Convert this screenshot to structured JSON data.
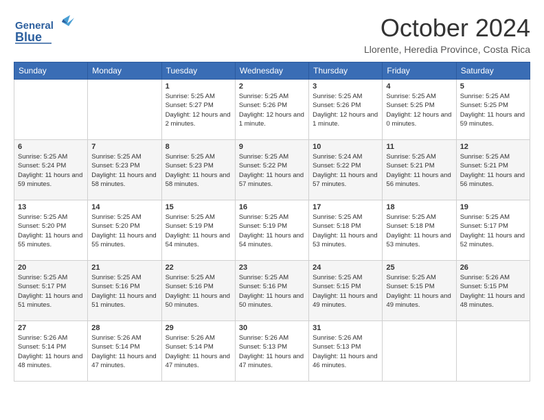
{
  "header": {
    "logo": {
      "general": "General",
      "blue": "Blue",
      "tagline": "GeneralBlue"
    },
    "title": "October 2024",
    "location": "Llorente, Heredia Province, Costa Rica"
  },
  "calendar": {
    "weekdays": [
      "Sunday",
      "Monday",
      "Tuesday",
      "Wednesday",
      "Thursday",
      "Friday",
      "Saturday"
    ],
    "weeks": [
      [
        {
          "day": "",
          "sunrise": "",
          "sunset": "",
          "daylight": ""
        },
        {
          "day": "",
          "sunrise": "",
          "sunset": "",
          "daylight": ""
        },
        {
          "day": "1",
          "sunrise": "Sunrise: 5:25 AM",
          "sunset": "Sunset: 5:27 PM",
          "daylight": "Daylight: 12 hours and 2 minutes."
        },
        {
          "day": "2",
          "sunrise": "Sunrise: 5:25 AM",
          "sunset": "Sunset: 5:26 PM",
          "daylight": "Daylight: 12 hours and 1 minute."
        },
        {
          "day": "3",
          "sunrise": "Sunrise: 5:25 AM",
          "sunset": "Sunset: 5:26 PM",
          "daylight": "Daylight: 12 hours and 1 minute."
        },
        {
          "day": "4",
          "sunrise": "Sunrise: 5:25 AM",
          "sunset": "Sunset: 5:25 PM",
          "daylight": "Daylight: 12 hours and 0 minutes."
        },
        {
          "day": "5",
          "sunrise": "Sunrise: 5:25 AM",
          "sunset": "Sunset: 5:25 PM",
          "daylight": "Daylight: 11 hours and 59 minutes."
        }
      ],
      [
        {
          "day": "6",
          "sunrise": "Sunrise: 5:25 AM",
          "sunset": "Sunset: 5:24 PM",
          "daylight": "Daylight: 11 hours and 59 minutes."
        },
        {
          "day": "7",
          "sunrise": "Sunrise: 5:25 AM",
          "sunset": "Sunset: 5:23 PM",
          "daylight": "Daylight: 11 hours and 58 minutes."
        },
        {
          "day": "8",
          "sunrise": "Sunrise: 5:25 AM",
          "sunset": "Sunset: 5:23 PM",
          "daylight": "Daylight: 11 hours and 58 minutes."
        },
        {
          "day": "9",
          "sunrise": "Sunrise: 5:25 AM",
          "sunset": "Sunset: 5:22 PM",
          "daylight": "Daylight: 11 hours and 57 minutes."
        },
        {
          "day": "10",
          "sunrise": "Sunrise: 5:24 AM",
          "sunset": "Sunset: 5:22 PM",
          "daylight": "Daylight: 11 hours and 57 minutes."
        },
        {
          "day": "11",
          "sunrise": "Sunrise: 5:25 AM",
          "sunset": "Sunset: 5:21 PM",
          "daylight": "Daylight: 11 hours and 56 minutes."
        },
        {
          "day": "12",
          "sunrise": "Sunrise: 5:25 AM",
          "sunset": "Sunset: 5:21 PM",
          "daylight": "Daylight: 11 hours and 56 minutes."
        }
      ],
      [
        {
          "day": "13",
          "sunrise": "Sunrise: 5:25 AM",
          "sunset": "Sunset: 5:20 PM",
          "daylight": "Daylight: 11 hours and 55 minutes."
        },
        {
          "day": "14",
          "sunrise": "Sunrise: 5:25 AM",
          "sunset": "Sunset: 5:20 PM",
          "daylight": "Daylight: 11 hours and 55 minutes."
        },
        {
          "day": "15",
          "sunrise": "Sunrise: 5:25 AM",
          "sunset": "Sunset: 5:19 PM",
          "daylight": "Daylight: 11 hours and 54 minutes."
        },
        {
          "day": "16",
          "sunrise": "Sunrise: 5:25 AM",
          "sunset": "Sunset: 5:19 PM",
          "daylight": "Daylight: 11 hours and 54 minutes."
        },
        {
          "day": "17",
          "sunrise": "Sunrise: 5:25 AM",
          "sunset": "Sunset: 5:18 PM",
          "daylight": "Daylight: 11 hours and 53 minutes."
        },
        {
          "day": "18",
          "sunrise": "Sunrise: 5:25 AM",
          "sunset": "Sunset: 5:18 PM",
          "daylight": "Daylight: 11 hours and 53 minutes."
        },
        {
          "day": "19",
          "sunrise": "Sunrise: 5:25 AM",
          "sunset": "Sunset: 5:17 PM",
          "daylight": "Daylight: 11 hours and 52 minutes."
        }
      ],
      [
        {
          "day": "20",
          "sunrise": "Sunrise: 5:25 AM",
          "sunset": "Sunset: 5:17 PM",
          "daylight": "Daylight: 11 hours and 51 minutes."
        },
        {
          "day": "21",
          "sunrise": "Sunrise: 5:25 AM",
          "sunset": "Sunset: 5:16 PM",
          "daylight": "Daylight: 11 hours and 51 minutes."
        },
        {
          "day": "22",
          "sunrise": "Sunrise: 5:25 AM",
          "sunset": "Sunset: 5:16 PM",
          "daylight": "Daylight: 11 hours and 50 minutes."
        },
        {
          "day": "23",
          "sunrise": "Sunrise: 5:25 AM",
          "sunset": "Sunset: 5:16 PM",
          "daylight": "Daylight: 11 hours and 50 minutes."
        },
        {
          "day": "24",
          "sunrise": "Sunrise: 5:25 AM",
          "sunset": "Sunset: 5:15 PM",
          "daylight": "Daylight: 11 hours and 49 minutes."
        },
        {
          "day": "25",
          "sunrise": "Sunrise: 5:25 AM",
          "sunset": "Sunset: 5:15 PM",
          "daylight": "Daylight: 11 hours and 49 minutes."
        },
        {
          "day": "26",
          "sunrise": "Sunrise: 5:26 AM",
          "sunset": "Sunset: 5:15 PM",
          "daylight": "Daylight: 11 hours and 48 minutes."
        }
      ],
      [
        {
          "day": "27",
          "sunrise": "Sunrise: 5:26 AM",
          "sunset": "Sunset: 5:14 PM",
          "daylight": "Daylight: 11 hours and 48 minutes."
        },
        {
          "day": "28",
          "sunrise": "Sunrise: 5:26 AM",
          "sunset": "Sunset: 5:14 PM",
          "daylight": "Daylight: 11 hours and 47 minutes."
        },
        {
          "day": "29",
          "sunrise": "Sunrise: 5:26 AM",
          "sunset": "Sunset: 5:14 PM",
          "daylight": "Daylight: 11 hours and 47 minutes."
        },
        {
          "day": "30",
          "sunrise": "Sunrise: 5:26 AM",
          "sunset": "Sunset: 5:13 PM",
          "daylight": "Daylight: 11 hours and 47 minutes."
        },
        {
          "day": "31",
          "sunrise": "Sunrise: 5:26 AM",
          "sunset": "Sunset: 5:13 PM",
          "daylight": "Daylight: 11 hours and 46 minutes."
        },
        {
          "day": "",
          "sunrise": "",
          "sunset": "",
          "daylight": ""
        },
        {
          "day": "",
          "sunrise": "",
          "sunset": "",
          "daylight": ""
        }
      ]
    ]
  }
}
